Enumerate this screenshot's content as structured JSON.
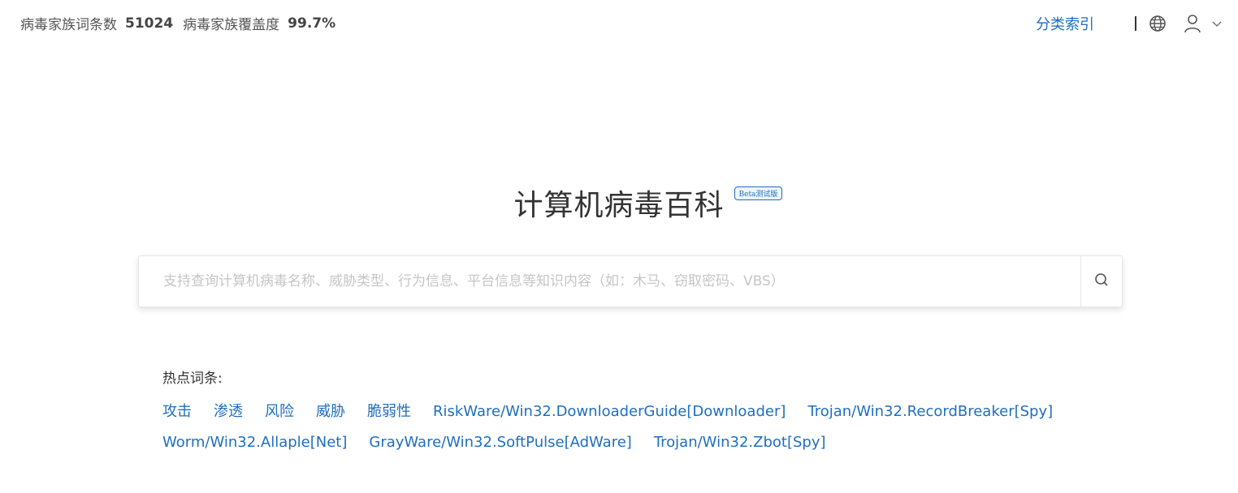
{
  "stats": {
    "family_terms_label": "病毒家族词条数",
    "family_terms_value": "51024",
    "coverage_label": "病毒家族覆盖度",
    "coverage_value": "99.7%"
  },
  "nav": {
    "category_index": "分类索引",
    "icons": [
      "globe-icon",
      "user-icon",
      "chevron-down-icon"
    ]
  },
  "title": "计算机病毒百科",
  "beta_badge": "Beta测试版",
  "search": {
    "placeholder": "支持查询计算机病毒名称、威胁类型、行为信息、平台信息等知识内容（如：木马、窃取密码、VBS）",
    "value": ""
  },
  "hot": {
    "label": "热点词条:",
    "items": [
      "攻击",
      "渗透",
      "风险",
      "威胁",
      "脆弱性",
      "RiskWare/Win32.DownloaderGuide[Downloader]",
      "Trojan/Win32.RecordBreaker[Spy]",
      "Worm/Win32.Allaple[Net]",
      "GrayWare/Win32.SoftPulse[AdWare]",
      "Trojan/Win32.Zbot[Spy]"
    ]
  },
  "colors": {
    "link": "#1f6fbf",
    "text": "#333333",
    "placeholder": "#c6c6c6"
  }
}
